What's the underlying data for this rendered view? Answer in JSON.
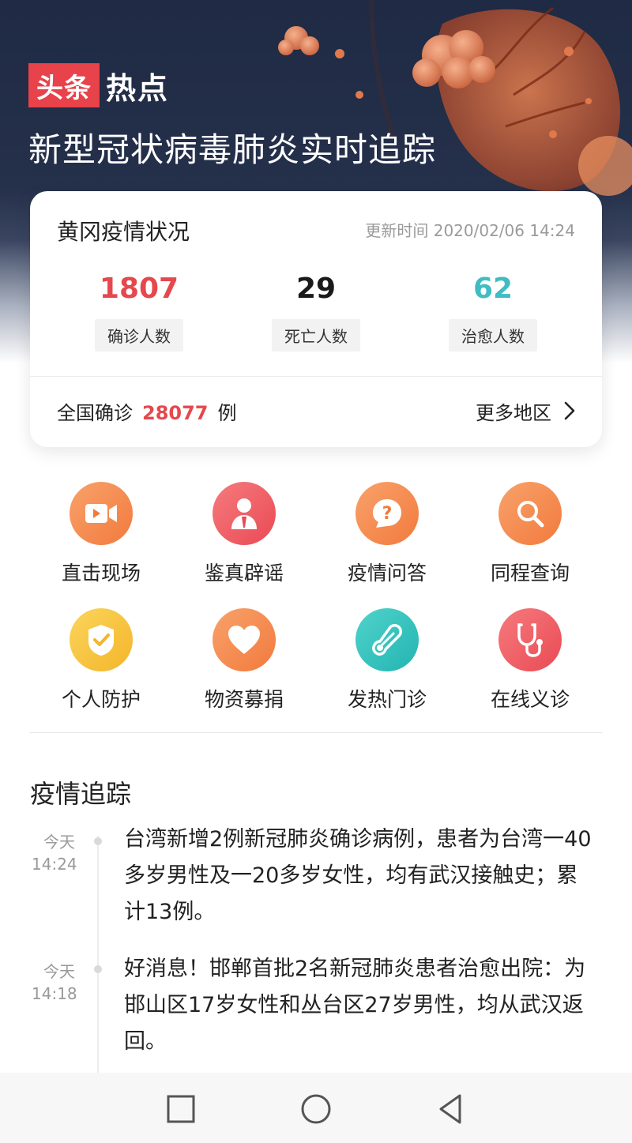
{
  "header": {
    "brand_red": "头条",
    "brand_white": "热点",
    "title": "新型冠状病毒肺炎实时追踪"
  },
  "status_card": {
    "title": "黄冈疫情状况",
    "update_time": "更新时间 2020/02/06 14:24",
    "stats": [
      {
        "value": "1807",
        "label": "确诊人数",
        "color": "#e5484d"
      },
      {
        "value": "29",
        "label": "死亡人数",
        "color": "#1a1a1a"
      },
      {
        "value": "62",
        "label": "治愈人数",
        "color": "#3fbdc3"
      }
    ],
    "national_prefix": "全国确诊",
    "national_count": "28077",
    "national_suffix": "例",
    "more_regions": "更多地区"
  },
  "services": [
    {
      "label": "直击现场",
      "icon": "video-camera-icon",
      "color": "#f6874e"
    },
    {
      "label": "鉴真辟谣",
      "icon": "person-badge-icon",
      "color": "#ef5a5f"
    },
    {
      "label": "疫情问答",
      "icon": "question-chat-icon",
      "color": "#f6874e"
    },
    {
      "label": "同程查询",
      "icon": "search-icon",
      "color": "#f6874e"
    },
    {
      "label": "个人防护",
      "icon": "shield-check-icon",
      "color": "#f8c53d"
    },
    {
      "label": "物资募捐",
      "icon": "heart-icon",
      "color": "#f6874e"
    },
    {
      "label": "发热门诊",
      "icon": "thermometer-icon",
      "color": "#36c4c0"
    },
    {
      "label": "在线义诊",
      "icon": "stethoscope-icon",
      "color": "#ef5a5f"
    }
  ],
  "tracking": {
    "title": "疫情追踪",
    "items": [
      {
        "day": "今天",
        "time": "14:24",
        "text": "台湾新增2例新冠肺炎确诊病例，患者为台湾一40多岁男性及一20多岁女性，均有武汉接触史；累计13例。"
      },
      {
        "day": "今天",
        "time": "14:18",
        "text": "好消息！邯郸首批2名新冠肺炎患者治愈出院：为邯山区17岁女性和丛台区27岁男性，均从武汉返回。"
      }
    ]
  },
  "navbar": {
    "buttons": [
      "recent-apps",
      "home",
      "back"
    ]
  }
}
